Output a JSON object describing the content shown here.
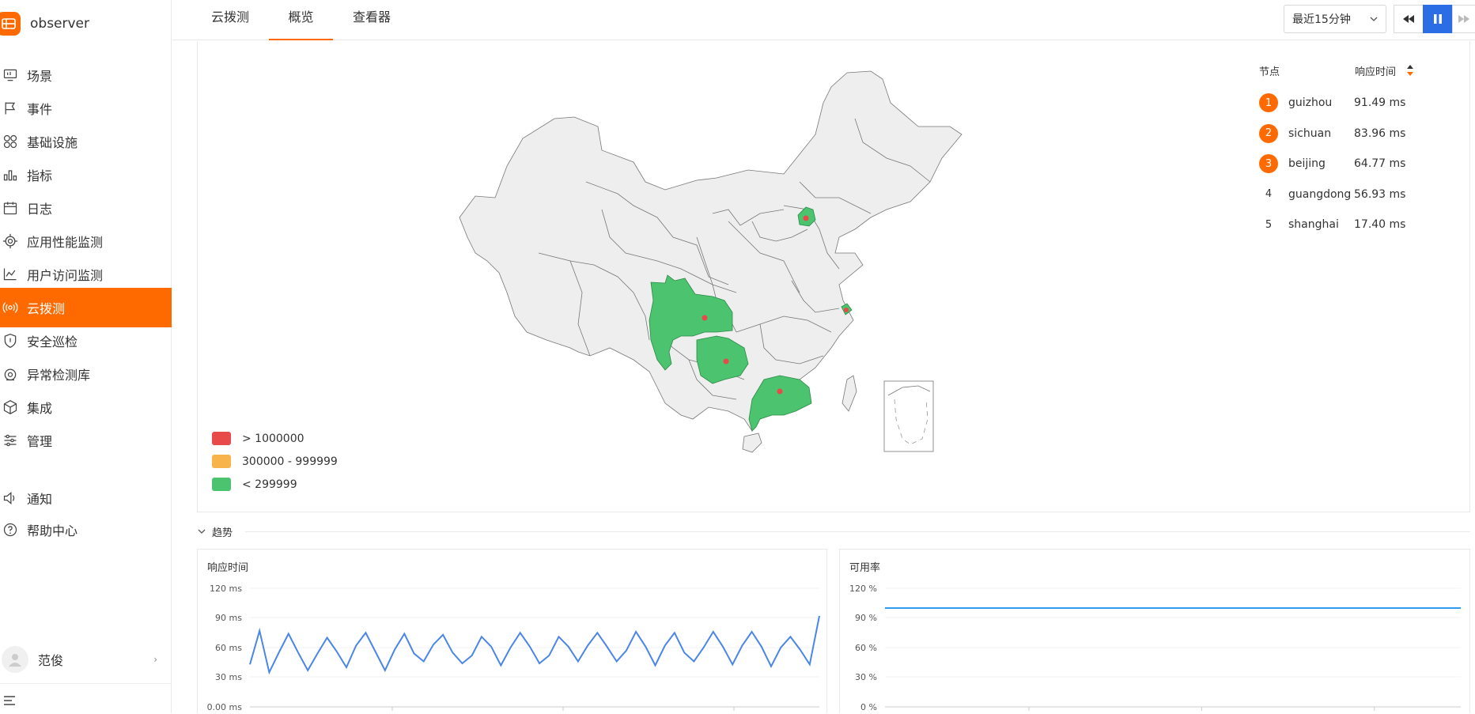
{
  "app": {
    "name": "observer"
  },
  "sidebar": {
    "items": [
      {
        "label": "场景",
        "icon": "monitor-icon"
      },
      {
        "label": "事件",
        "icon": "flag-icon"
      },
      {
        "label": "基础设施",
        "icon": "grid-icon"
      },
      {
        "label": "指标",
        "icon": "bar-chart-icon"
      },
      {
        "label": "日志",
        "icon": "calendar-icon"
      },
      {
        "label": "应用性能监测",
        "icon": "target-icon"
      },
      {
        "label": "用户访问监测",
        "icon": "line-chart-icon"
      },
      {
        "label": "云拨测",
        "icon": "signal-icon",
        "active": true
      },
      {
        "label": "安全巡检",
        "icon": "shield-icon"
      },
      {
        "label": "异常检测库",
        "icon": "radar-icon"
      },
      {
        "label": "集成",
        "icon": "cube-icon"
      },
      {
        "label": "管理",
        "icon": "sliders-icon"
      }
    ],
    "bottom": [
      {
        "label": "通知",
        "icon": "speaker-icon"
      },
      {
        "label": "帮助中心",
        "icon": "help-icon"
      }
    ],
    "user": {
      "name": "范俊"
    }
  },
  "tabs": [
    {
      "label": "云拨测"
    },
    {
      "label": "概览",
      "active": true
    },
    {
      "label": "查看器"
    }
  ],
  "time_range": {
    "selected": "最近15分钟"
  },
  "ranking": {
    "col_node": "节点",
    "col_time": "响应时间",
    "rows": [
      {
        "rank": "1",
        "name": "guizhou",
        "value": "91.49 ms"
      },
      {
        "rank": "2",
        "name": "sichuan",
        "value": "83.96 ms"
      },
      {
        "rank": "3",
        "name": "beijing",
        "value": "64.77 ms"
      },
      {
        "rank": "4",
        "name": "guangdong",
        "value": "56.93 ms"
      },
      {
        "rank": "5",
        "name": "shanghai",
        "value": "17.40 ms"
      }
    ]
  },
  "legend": [
    {
      "label": "> 1000000",
      "color": "#e84a4a"
    },
    {
      "label": "300000 - 999999",
      "color": "#f8b34a"
    },
    {
      "label": "< 299999",
      "color": "#4cc36e"
    }
  ],
  "trend": {
    "section_label": "趋势"
  },
  "chart_data": [
    {
      "type": "line",
      "title": "响应时间",
      "y_ticks": [
        "120 ms",
        "90 ms",
        "60 ms",
        "30 ms",
        "0.00 ms"
      ],
      "ylim": [
        0,
        120
      ],
      "series": [
        {
          "values": [
            43,
            77,
            35,
            55,
            74,
            55,
            37,
            54,
            70,
            56,
            40,
            62,
            75,
            56,
            37,
            58,
            74,
            54,
            46,
            63,
            73,
            55,
            44,
            52,
            71,
            61,
            42,
            60,
            75,
            61,
            44,
            52,
            71,
            61,
            46,
            62,
            75,
            61,
            46,
            57,
            76,
            61,
            42,
            62,
            75,
            55,
            46,
            60,
            76,
            61,
            43,
            62,
            76,
            61,
            41,
            60,
            71,
            58,
            43,
            92
          ]
        }
      ],
      "color": "#4a86e8"
    },
    {
      "type": "line",
      "title": "可用率",
      "y_ticks": [
        "120 %",
        "90 %",
        "60 %",
        "30 %",
        "0 %"
      ],
      "ylim": [
        0,
        120
      ],
      "series": [
        {
          "values": [
            100,
            100
          ]
        }
      ],
      "color": "#2f9bf0"
    }
  ]
}
